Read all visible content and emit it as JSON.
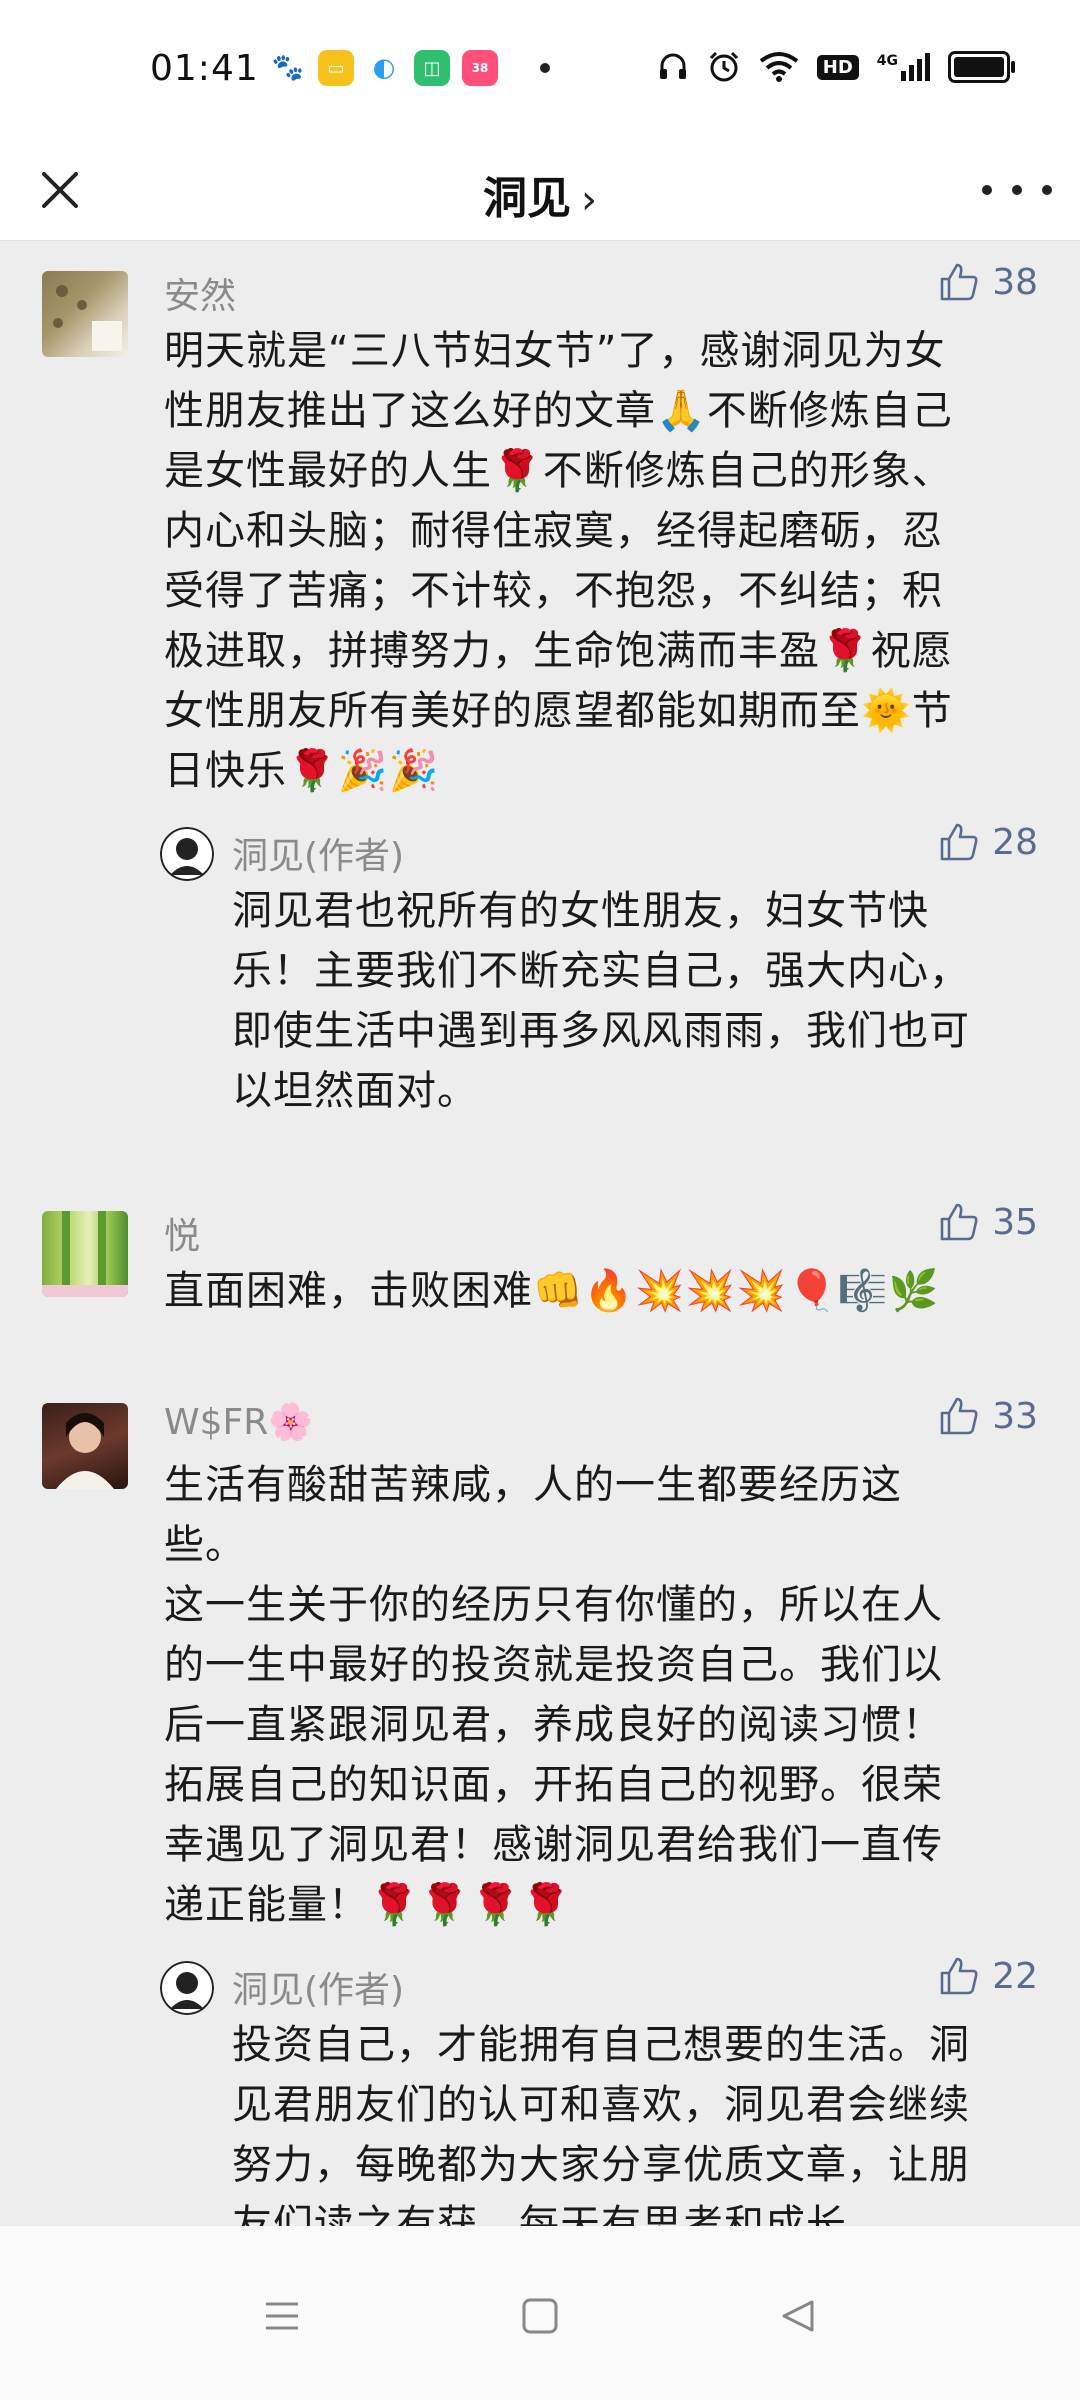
{
  "status": {
    "time": "01:41",
    "network": "4G",
    "hd": "HD"
  },
  "nav": {
    "title": "洞见",
    "chevron": "›"
  },
  "comments": [
    {
      "user": "安然",
      "likes": "38",
      "text": "明天就是“三八节妇女节”了，感谢洞见为女\n性朋友推出了这么好的文章🙏不断修炼自己\n是女性最好的人生🌹不断修炼自己的形象、\n内心和头脑；耐得住寂寞，经得起磨砺，忍\n受得了苦痛；不计较，不抱怨，不纠结；积\n极进取，拼搏努力，生命饱满而丰盈🌹祝愿\n女性朋友所有美好的愿望都能如期而至🌞节\n日快乐🌹🎉🎉",
      "reply": {
        "user": "洞见(作者)",
        "likes": "28",
        "text": "洞见君也祝所有的女性朋友，妇女节快\n乐！主要我们不断充实自己，强大内心，\n即使生活中遇到再多风风雨雨，我们也可\n以坦然面对。"
      }
    },
    {
      "user": "悦",
      "likes": "35",
      "text": "直面困难，击败困难👊🔥💥💥💥🎈🎼🌿"
    },
    {
      "user": "W$FR🌸",
      "likes": "33",
      "text": "生活有酸甜苦辣咸，人的一生都要经历这\n些。\n这一生关于你的经历只有你懂的，所以在人\n的一生中最好的投资就是投资自己。我们以\n后一直紧跟洞见君，养成良好的阅读习惯！\n拓展自己的知识面，开拓自己的视野。很荣\n幸遇见了洞见君！感谢洞见君给我们一直传\n递正能量！🌹🌹🌹🌹",
      "reply": {
        "user": "洞见(作者)",
        "likes": "22",
        "text": "投资自己，才能拥有自己想要的生活。洞\n见君朋友们的认可和喜欢，洞见君会继续\n努力，每晚都为大家分享优质文章，让朋\n友们读之有获，每天有思考和成长。"
      }
    }
  ],
  "colors": {
    "background": "#ededed",
    "like": "#5b6b8c",
    "username": "#8a8a8a"
  }
}
